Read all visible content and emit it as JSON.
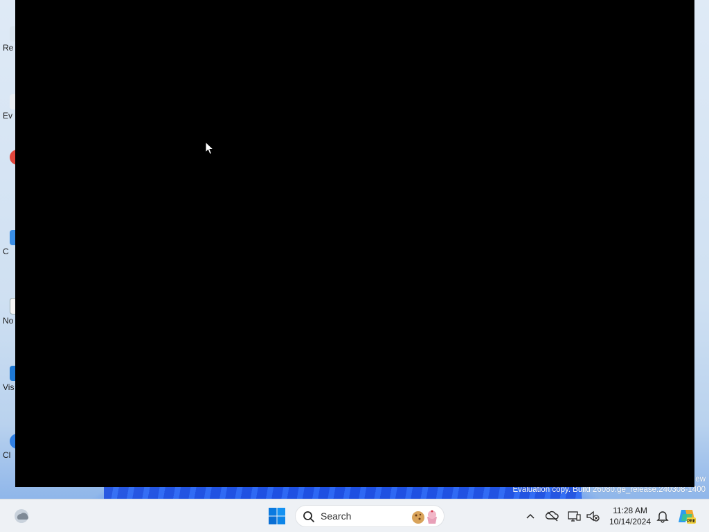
{
  "desktop": {
    "icons": [
      {
        "label": "Re",
        "name": "recycle-bin"
      },
      {
        "label": "Ev",
        "name": "shortcut-ev"
      },
      {
        "label": "",
        "name": "shortcut-red-app"
      },
      {
        "label": "C",
        "name": "shortcut-c"
      },
      {
        "label": "No",
        "name": "shortcut-notepad"
      },
      {
        "label": "Vis",
        "name": "shortcut-visual-studio"
      },
      {
        "label": "Cl",
        "name": "shortcut-cl"
      }
    ]
  },
  "watermark": {
    "line1": "ew",
    "line2": "Evaluation copy. Build 26080.ge_release.240308-1400"
  },
  "taskbar": {
    "search_placeholder": "Search",
    "clock_time": "11:28 AM",
    "clock_date": "10/14/2024",
    "accent_color": "#0067c0"
  },
  "icons": {
    "widgets": "weather-widget-icon",
    "start": "windows-start-icon",
    "search": "search-icon",
    "tray_overflow": "chevron-up-icon",
    "onedrive": "cloud-offline-icon",
    "network": "network-icon",
    "volume": "volume-muted-icon",
    "notifications": "bell-icon",
    "copilot": "copilot-icon"
  }
}
